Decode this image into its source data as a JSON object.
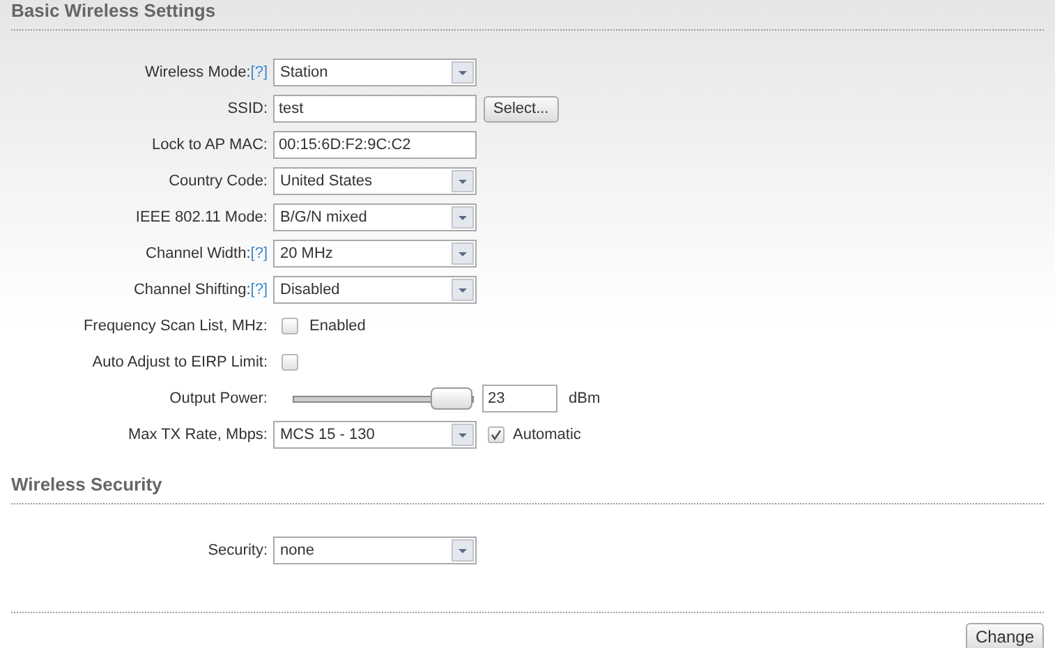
{
  "sections": [
    {
      "title": "Basic Wireless Settings",
      "rows": [
        {
          "kind": "select",
          "label": "Wireless Mode:",
          "help": "[?]",
          "value": "Station"
        },
        {
          "kind": "text",
          "label": "SSID:",
          "value": "test",
          "button": "Select..."
        },
        {
          "kind": "text",
          "label": "Lock to AP MAC:",
          "value": "00:15:6D:F2:9C:C2"
        },
        {
          "kind": "select",
          "label": "Country Code:",
          "value": "United States"
        },
        {
          "kind": "select",
          "label": "IEEE 802.11 Mode:",
          "value": "B/G/N mixed"
        },
        {
          "kind": "select",
          "label": "Channel Width:",
          "help": "[?]",
          "value": "20 MHz"
        },
        {
          "kind": "select",
          "label": "Channel Shifting:",
          "help": "[?]",
          "value": "Disabled"
        },
        {
          "kind": "checkbox",
          "label": "Frequency Scan List, MHz:",
          "checked": false,
          "text": "Enabled"
        },
        {
          "kind": "checkbox",
          "label": "Auto Adjust to EIRP Limit:",
          "checked": false
        },
        {
          "kind": "slider",
          "label": "Output Power:",
          "level": 1,
          "value": "23",
          "unit": "dBm"
        },
        {
          "kind": "select",
          "label": "Max TX Rate, Mbps:",
          "value": "MCS 15 - 130",
          "checkbox": {
            "checked": true,
            "text": "Automatic"
          }
        }
      ]
    },
    {
      "title": "Wireless Security",
      "rows": [
        {
          "kind": "select",
          "label": "Security:",
          "value": "none"
        }
      ]
    }
  ],
  "button": "Change"
}
